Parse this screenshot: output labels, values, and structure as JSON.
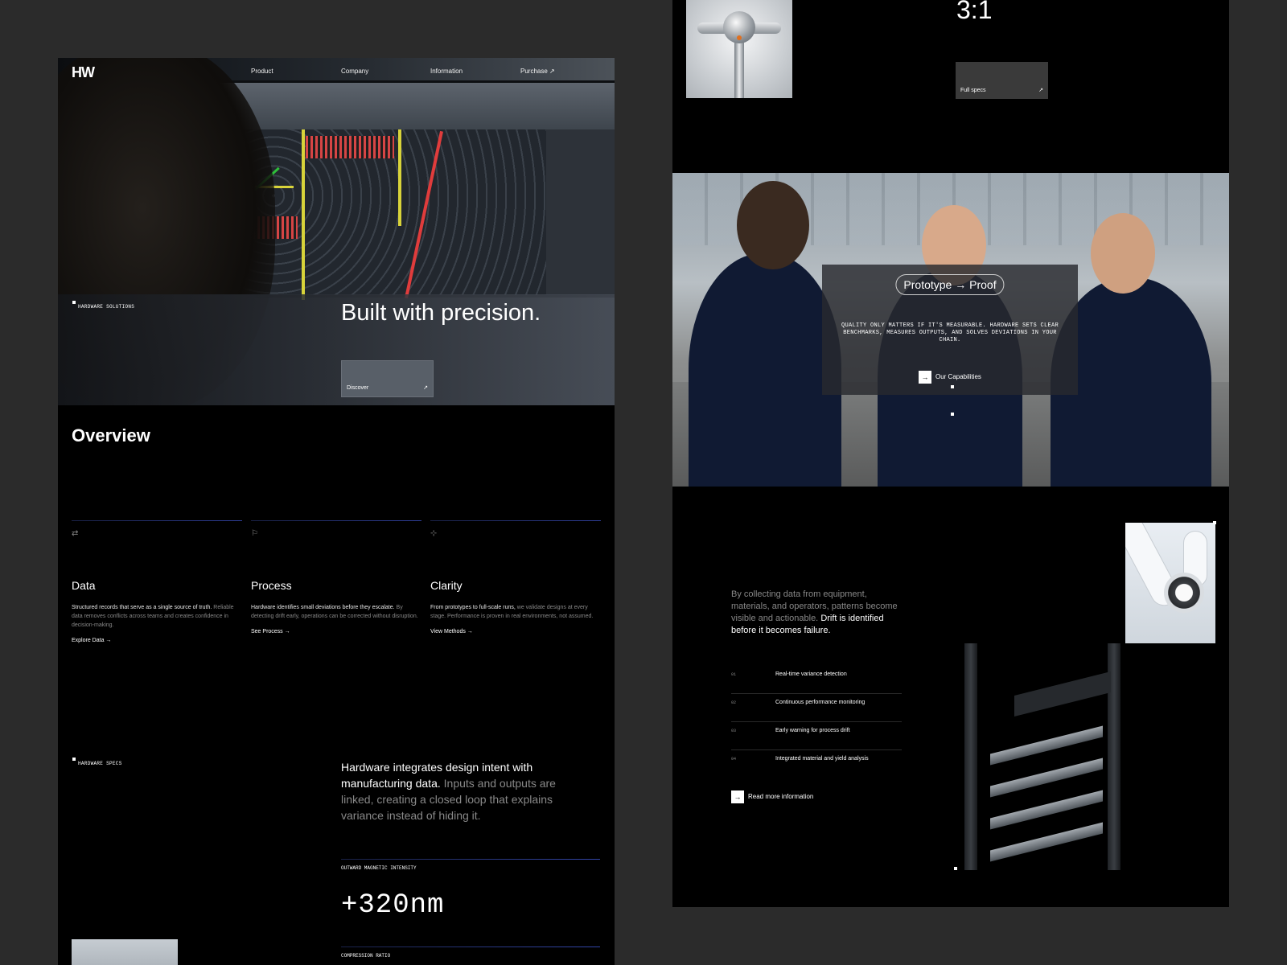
{
  "brand": {
    "logo": "HW"
  },
  "nav": {
    "items": [
      "Product",
      "Company",
      "Information"
    ],
    "purchase": "Purchase ↗"
  },
  "hero": {
    "tag": "HARDWARE SOLUTIONS",
    "title": "Built with precision.",
    "cta": "Discover",
    "cta_icon": "↗"
  },
  "overview": {
    "title": "Overview",
    "columns": [
      {
        "icon": "⇄",
        "icon_name": "exchange-icon",
        "title": "Data",
        "lead": "Structured records that serve as a single source of truth.",
        "body": "Reliable data removes conflicts across teams and creates confidence in decision-making.",
        "link": "Explore Data →"
      },
      {
        "icon": "⚐",
        "icon_name": "flag-icon",
        "title": "Process",
        "lead": "Hardware identifies small deviations before they escalate.",
        "body": "By detecting drift early, operations can be corrected without disruption.",
        "link": "See Process →"
      },
      {
        "icon": "⊹",
        "icon_name": "crosshair-icon",
        "title": "Clarity",
        "lead": "From prototypes to full-scale runs,",
        "body": "we validate designs at every stage. Performance is proven in real environments, not assumed.",
        "link": "View Methods →"
      }
    ]
  },
  "specs": {
    "tag": "HARDWARE SPECS",
    "lead": "Hardware integrates design intent with manufacturing data.",
    "body": "Inputs and outputs are linked, creating a closed loop that explains variance instead of hiding it.",
    "metric1_label": "OUTWARD MAGNETIC INTENSITY",
    "metric1_value": "+320nm",
    "metric2_label": "COMPRESSION RATIO"
  },
  "right": {
    "ratio": "3:1",
    "fullspecs": "Full specs",
    "fullspecs_icon": "↗",
    "pill": "Prototype → Proof",
    "proof_text": "QUALITY ONLY MATTERS IF IT'S MEASURABLE. HARDWARE SETS CLEAR BENCHMARKS, MEASURES OUTPUTS, AND SOLVES DEVIATIONS IN YOUR CHAIN.",
    "capabilities": "Our Capabilities",
    "drift_lead": "By collecting data from equipment, materials, and operators, patterns become visible and actionable.",
    "drift_emph": "Drift is identified before it becomes failure.",
    "list": [
      {
        "n": "01",
        "t": "Real-time variance detection"
      },
      {
        "n": "02",
        "t": "Continuous performance monitoring"
      },
      {
        "n": "03",
        "t": "Early warning for process drift"
      },
      {
        "n": "04",
        "t": "Integrated material and yield analysis"
      }
    ],
    "readmore": "Read more information",
    "arrow": "→"
  },
  "colors": {
    "page_bg": "#2b2b2b",
    "panel_bg": "#000000",
    "accent_rule": "#3346aa"
  }
}
